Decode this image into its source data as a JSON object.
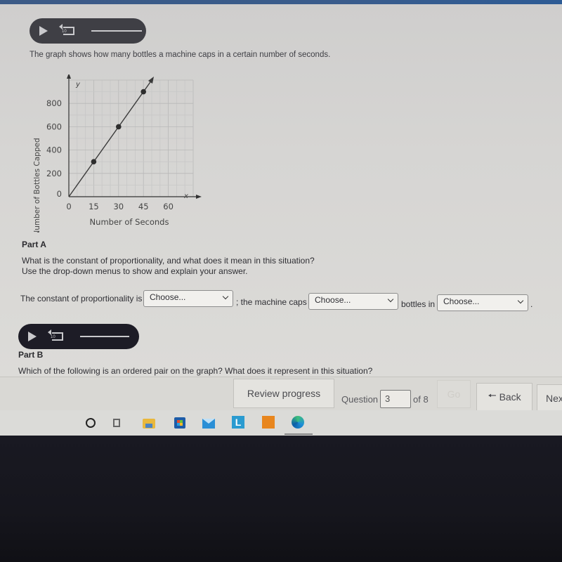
{
  "audio_player_1": {
    "replay_label": "10"
  },
  "intro_text": "The graph shows how many bottles a machine caps in a certain number of seconds.",
  "chart_data": {
    "type": "line",
    "title": "",
    "xlabel": "Number of Seconds",
    "ylabel": "Number of Bottles Capped",
    "x_axis_letter": "x",
    "y_axis_letter": "y",
    "x_ticks": [
      0,
      15,
      30,
      45,
      60
    ],
    "y_ticks": [
      0,
      200,
      400,
      600,
      800
    ],
    "x_tick_labels": [
      "0",
      "15",
      "30",
      "45",
      "60"
    ],
    "y_tick_labels": [
      "0",
      "200",
      "400",
      "600",
      "800"
    ],
    "xlim": [
      0,
      75
    ],
    "ylim": [
      0,
      1000
    ],
    "grid": true,
    "series": [
      {
        "name": "bottles capped",
        "line": {
          "x": [
            0,
            50
          ],
          "y": [
            0,
            1000
          ]
        },
        "points": {
          "x": [
            15,
            30,
            45
          ],
          "y": [
            300,
            600,
            900
          ]
        }
      }
    ]
  },
  "part_a": {
    "title": "Part A",
    "question": "What is the constant of proportionality, and what does it mean in this situation?",
    "instruction": "Use the drop-down menus to show and explain your answer.",
    "sentence_1": "The constant of proportionality is",
    "sentence_2": "; the machine caps",
    "sentence_3": "bottles in",
    "sentence_end": ".",
    "dropdown_1": "Choose...",
    "dropdown_2": "Choose...",
    "dropdown_3": "Choose..."
  },
  "audio_player_2": {
    "replay_label": "10"
  },
  "part_b": {
    "title": "Part B",
    "question": "Which of the following is an ordered pair on the graph? What does it represent in this situation?"
  },
  "footer": {
    "review_progress": "Review progress",
    "question_label": "Question",
    "question_value": "3",
    "of_label": "of 8",
    "go_label": "Go",
    "back_label": "Back",
    "next_label": "Next"
  },
  "taskbar": {
    "icons": [
      "search-circle",
      "task-view",
      "file-explorer",
      "microsoft-store",
      "mail",
      "l-app",
      "orange-app",
      "edge-browser"
    ]
  }
}
